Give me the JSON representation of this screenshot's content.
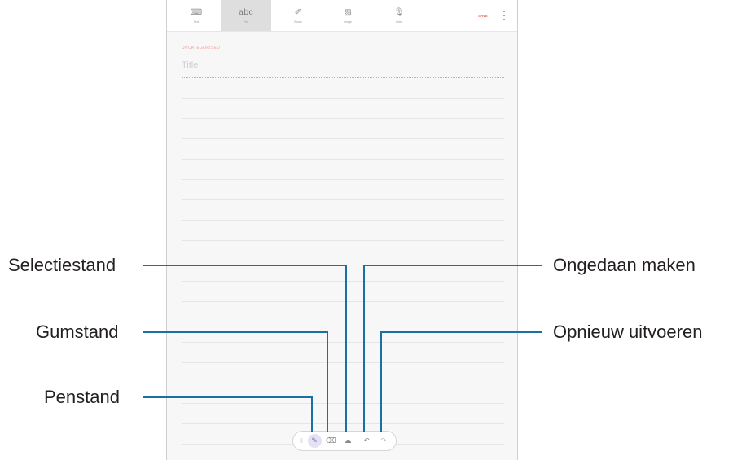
{
  "toolbar": {
    "tools": [
      {
        "icon": "keyboard-icon",
        "glyph": "⌨",
        "label": "Text"
      },
      {
        "icon": "handwriting-icon",
        "glyph": "abc",
        "label": "Pen",
        "active": true
      },
      {
        "icon": "brush-icon",
        "glyph": "✐",
        "label": "Brush"
      },
      {
        "icon": "image-icon",
        "glyph": "▨",
        "label": "Image"
      },
      {
        "icon": "microphone-icon",
        "glyph": "🎙",
        "label": "Voice"
      }
    ],
    "save_label": "SAVE"
  },
  "note": {
    "category": "UNCATEGORISED",
    "title_placeholder": "Title"
  },
  "pen_toolbar": {
    "handle_glyph": "⠿",
    "pen_glyph": "✎",
    "eraser_glyph": "⌫",
    "selection_glyph": "☁",
    "undo_glyph": "↶",
    "redo_glyph": "↷"
  },
  "callouts": {
    "selection_mode": "Selectiestand",
    "eraser_mode": "Gumstand",
    "pen_mode": "Penstand",
    "undo": "Ongedaan maken",
    "redo": "Opnieuw uitvoeren"
  },
  "colors": {
    "accent": "#e86a5a",
    "callout_line": "#1a6fa3",
    "pen_highlight": "#e4e1f3"
  }
}
